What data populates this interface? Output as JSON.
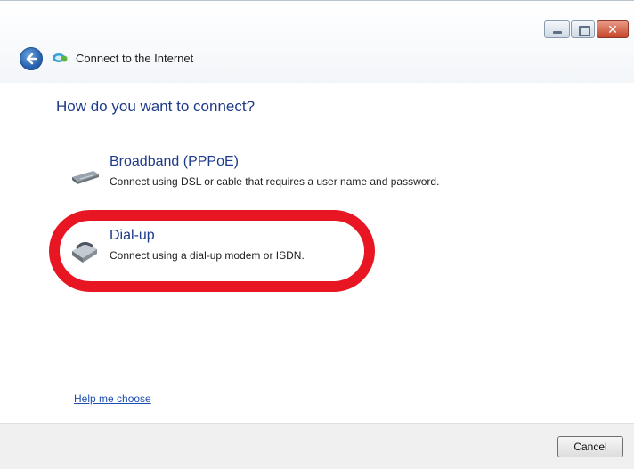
{
  "window": {
    "title": "Connect to the Internet",
    "controls": {
      "close_glyph": "✕"
    }
  },
  "main": {
    "heading": "How do you want to connect?",
    "options": [
      {
        "title": "Broadband (PPPoE)",
        "description": "Connect using DSL or cable that requires a user name and password.",
        "icon": "broadband-modem-icon"
      },
      {
        "title": "Dial-up",
        "description": "Connect using a dial-up modem or ISDN.",
        "icon": "dialup-modem-icon",
        "highlighted": true
      }
    ],
    "help_link": "Help me choose"
  },
  "footer": {
    "cancel_label": "Cancel"
  },
  "colors": {
    "heading": "#1e3a8a",
    "highlight": "#e81622",
    "link": "#1f4fb0"
  }
}
